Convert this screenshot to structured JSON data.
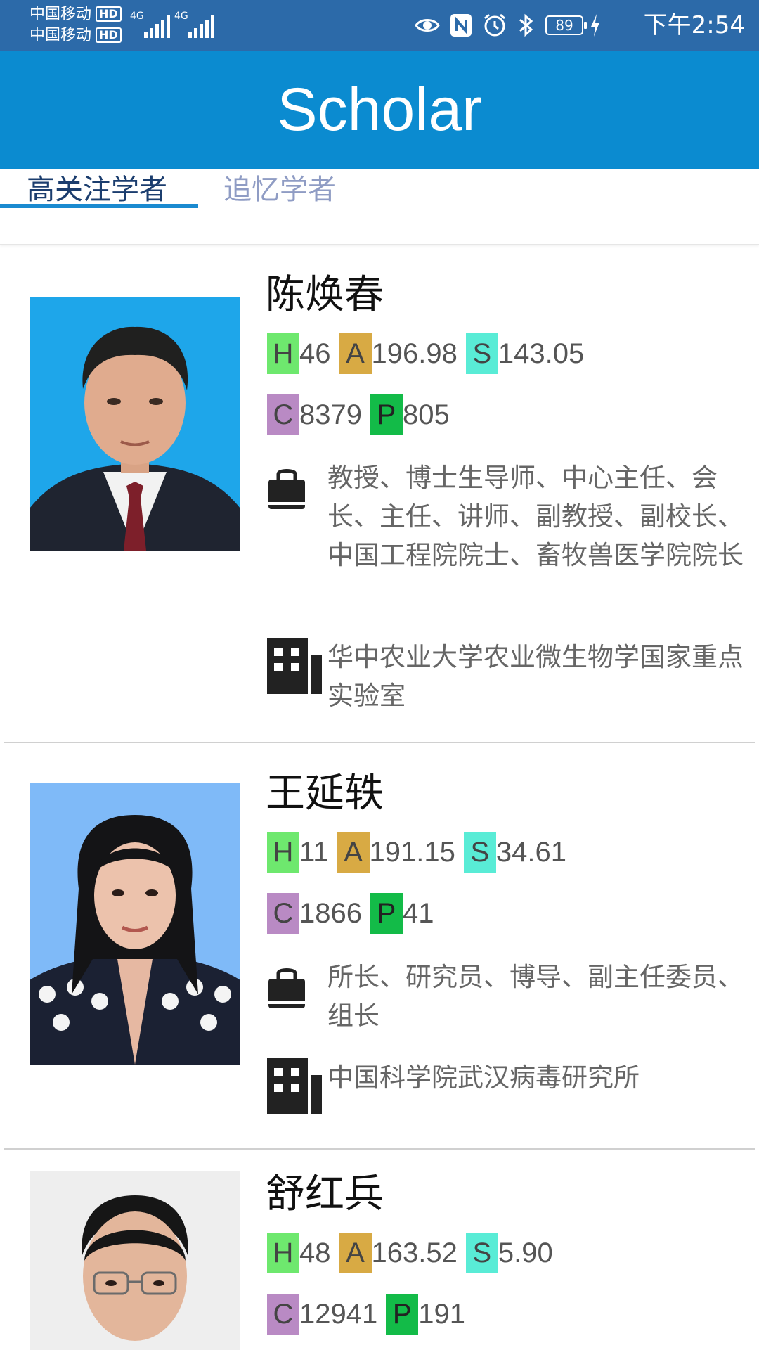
{
  "status_bar": {
    "carrier_1": "中国移动",
    "carrier_2": "中国移动",
    "hd_badge": "HD",
    "network_label": "4G",
    "battery_level": "89",
    "time": "下午2:54",
    "icons": [
      "eye-icon",
      "nfc-icon",
      "alarm-icon",
      "bluetooth-icon",
      "battery-icon",
      "charging-icon"
    ]
  },
  "app_bar": {
    "title": "Scholar"
  },
  "tabs": [
    {
      "label": "高关注学者",
      "selected": true
    },
    {
      "label": "追忆学者",
      "selected": false
    }
  ],
  "colors": {
    "status_bar_bg": "#2c6aa9",
    "app_bar_bg": "#0b8bd0",
    "tab_indicator": "#1a8ad0",
    "badge_h": "#6ee86e",
    "badge_a": "#d8aa44",
    "badge_s": "#59ecd6",
    "badge_c": "#b98ac4",
    "badge_p": "#13bb48"
  },
  "scholars": [
    {
      "name": "陈焕春",
      "metrics": {
        "h": "46",
        "a": "196.98",
        "s": "143.05",
        "c": "8379",
        "p": "805"
      },
      "positions": "教授、博士生导师、中心主任、会长、主任、讲师、副教授、副校长、中国工程院院士、畜牧兽医学院院长",
      "affiliation": "华中农业大学农业微生物学国家重点实验室"
    },
    {
      "name": "王延轶",
      "metrics": {
        "h": "11",
        "a": "191.15",
        "s": "34.61",
        "c": "1866",
        "p": "41"
      },
      "positions": "所长、研究员、博导、副主任委员、组长",
      "affiliation": "中国科学院武汉病毒研究所"
    },
    {
      "name": "舒红兵",
      "metrics": {
        "h": "48",
        "a": "163.52",
        "s": "5.90",
        "c": "12941",
        "p": "191"
      }
    }
  ],
  "metric_labels": {
    "h": "H",
    "a": "A",
    "s": "S",
    "c": "C",
    "p": "P"
  }
}
